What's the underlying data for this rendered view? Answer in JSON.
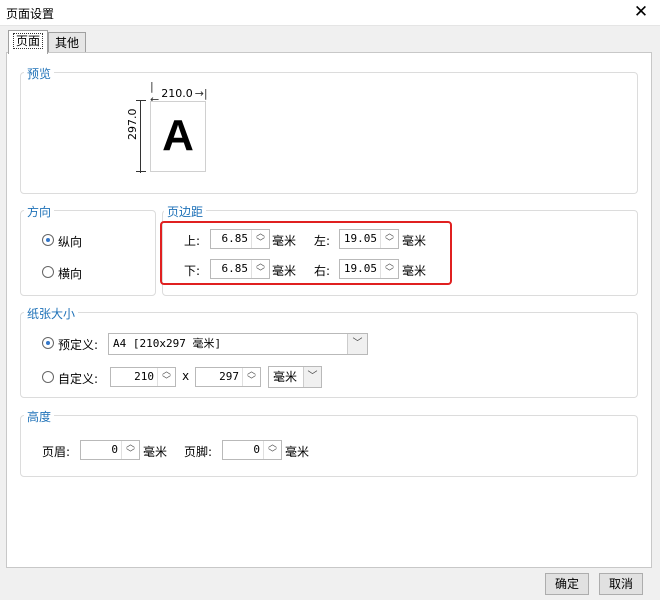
{
  "window": {
    "title": "页面设置",
    "close_glyph": "✕"
  },
  "tabs": [
    {
      "label": "页面"
    },
    {
      "label": "其他"
    }
  ],
  "preview": {
    "group_label": "预览",
    "width_label": "210.0",
    "height_label": "297.0",
    "letter": "A"
  },
  "orientation": {
    "group_label": "方向",
    "options": [
      {
        "label": "纵向",
        "selected": true
      },
      {
        "label": "横向",
        "selected": false
      }
    ]
  },
  "margins": {
    "group_label": "页边距",
    "top": {
      "label": "上:",
      "value": "6.85",
      "unit": "毫米"
    },
    "left": {
      "label": "左:",
      "value": "19.05",
      "unit": "毫米"
    },
    "bottom": {
      "label": "下:",
      "value": "6.85",
      "unit": "毫米"
    },
    "right": {
      "label": "右:",
      "value": "19.05",
      "unit": "毫米"
    },
    "highlight_color": "#e02020"
  },
  "paper": {
    "group_label": "纸张大小",
    "predefined_label": "预定义:",
    "predefined_value": "A4 [210x297 毫米]",
    "custom_label": "自定义:",
    "custom_width": "210",
    "times": "x",
    "custom_height": "297",
    "custom_unit": "毫米"
  },
  "height": {
    "group_label": "高度",
    "header": {
      "label": "页眉:",
      "value": "0",
      "unit": "毫米"
    },
    "footer": {
      "label": "页脚:",
      "value": "0",
      "unit": "毫米"
    }
  },
  "footer_buttons": {
    "ok": "确定",
    "cancel": "取消"
  },
  "colors": {
    "accent": "#1f72b8",
    "highlight": "#e02020"
  }
}
